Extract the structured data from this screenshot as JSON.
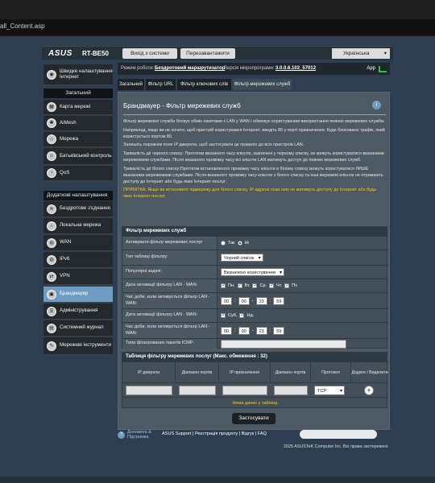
{
  "browser": {
    "url_fragment": "all_Content.asp"
  },
  "header": {
    "logo": "ASUS",
    "model": "RT-BE50",
    "logout": "Вихід з системи",
    "reboot": "Перезавантажити",
    "language": "Українська"
  },
  "status": {
    "mode_label": "Режим роботи:",
    "mode_value": "Бездротовий маршрутизатор",
    "fw_label": "Версія мікропрограми:",
    "fw_value": "3.0.0.6.102_57012",
    "app": "App"
  },
  "sidebar": {
    "quick": "Швидке налаштування Інтернет",
    "general_head": "Загальний",
    "general": [
      "Карта мережі",
      "AiMesh",
      "Мережа",
      "Батьківський контроль",
      "QoS"
    ],
    "advanced_head": "Додаткові налаштування",
    "advanced": [
      "Бездротове з'єднання",
      "Локальна мережа",
      "WAN",
      "IPv6",
      "VPN",
      "Брандмауер",
      "Адміністрування",
      "Системний журнал",
      "Мережеві інструменти"
    ]
  },
  "tabs": [
    "Загальний",
    "Фільтр URL",
    "Фільтр ключових слів",
    "Фільтр мережевих служб"
  ],
  "page": {
    "title": "Брандмауер - Фільтр мережевих служб",
    "para1": "Фільтр мережевої служби блокує обмін пакетами з LAN у WAN і обмежує користувачеві використання певних мережевих служби.",
    "para2": "Наприклад, якщо ви не хочете, щоб пристрій користувався Інтернет, введіть 80 у порті призначення. Буде блоковано трафік, який користується портом 80.",
    "para3": "Залишіть порожнім поле IP джерела, щоб застосувати це правило до всіх пристроїв LAN.",
    "para4": "Тривалість дії чорного списку: Протягом вказаного часу клієнти, зазначені у чорному списку, не можуть користуватися вказаними мережевими службами. Після вказаного проміжку часу всі клієнти LAN матимуть доступ до певних мережевих служб.",
    "para5": "Тривалість дії білого списку:Протягом встановленого проміжку часу клієнти в білому списку можуть користуватися ЛИШЕ вказаними мережевими службами. Після вказаного проміжку часу клієнти з білого списку та інші мережеві клієнти не отримають доступу до Інтернет або будь-яких Інтернет-послуг.",
    "note": "ПРИМІТКА: Якщо ви встановите підмережу для білого списку, IP-адреси поза нею не матимуть доступу до Інтернет або будь-яких Інтернет-послуг."
  },
  "form": {
    "header": "Фільтр мережевих служб",
    "enable_label": "Активувати фільтр мережевих послуг",
    "yes": "Так",
    "no": "Ні",
    "filter_type_label": "Тип таблиці фільтру:",
    "filter_type_value": "Чорний список",
    "popular_label": "Популярні задачі:",
    "popular_value": "Визначено користувачем",
    "date_label": "Дата активації фільтру LAN - WAN:",
    "days_week": [
      "Пн.",
      "Вт.",
      "Ср.",
      "Чт.",
      "Пт."
    ],
    "time_label": "Час доби, коли активується фільтр LAN - WAN:",
    "time1": [
      "00",
      "00",
      "23",
      "59"
    ],
    "days_weekend": [
      "Суб.",
      "Нд."
    ],
    "time2": [
      "00",
      "00",
      "23",
      "59"
    ],
    "icmp_label": "Типи фільтрованих пакетів ICMP:"
  },
  "rules": {
    "header": "Таблиця фільтру мережевих послуг (Макс. обмеження : 32)",
    "cols": [
      "IP джерела",
      "Діапазон портів",
      "IP призначення",
      "Діапазон портів",
      "Протокол",
      "Додати / Видалити"
    ],
    "protocol": "TCP",
    "empty": "Нема даних у таблиці."
  },
  "apply": "Застосувати",
  "footer": {
    "help": "Допомога & Підтримка",
    "links": "ASUS Support | Реєстрація продукту | Відгук | FAQ",
    "copyright": "2025 ASUSTeK Computer Inc. Всі права застережені."
  }
}
